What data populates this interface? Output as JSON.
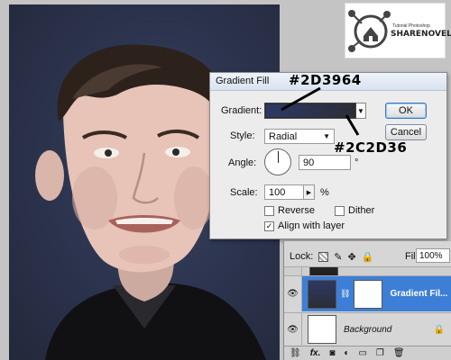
{
  "dialog": {
    "title": "Gradient Fill",
    "gradient_label": "Gradient:",
    "style_label": "Style:",
    "style_value": "Radial",
    "angle_label": "Angle:",
    "angle_value": "90",
    "angle_unit": "°",
    "scale_label": "Scale:",
    "scale_value": "100",
    "scale_unit": "%",
    "reverse_label": "Reverse",
    "reverse_checked": false,
    "dither_label": "Dither",
    "dither_checked": false,
    "align_label": "Align with layer",
    "align_checked": true,
    "ok_label": "OK",
    "cancel_label": "Cancel",
    "gradient_colors": [
      "#2D3964",
      "#2C2D36"
    ]
  },
  "annotations": {
    "color_start": "#2D3964",
    "color_end": "#2C2D36"
  },
  "logo": {
    "brand": "SHARENOVEL",
    "tagline": "Tutorial Photoshop"
  },
  "layers": {
    "lock_label": "Lock:",
    "fill_label": "Fill:",
    "fill_value": "100%",
    "items": [
      {
        "name": "Gradient Fil...",
        "selected": true,
        "visible": true
      },
      {
        "name": "Background",
        "selected": false,
        "visible": true,
        "locked": true
      }
    ],
    "bottom_icons": [
      "link-icon",
      "fx-icon",
      "mask-icon",
      "adjustment-icon",
      "folder-icon",
      "new-layer-icon",
      "trash-icon"
    ],
    "fx_label": "fx."
  },
  "colors": {
    "selected_layer": "#3d7fd6",
    "canvas_bg": "#2d3550"
  }
}
